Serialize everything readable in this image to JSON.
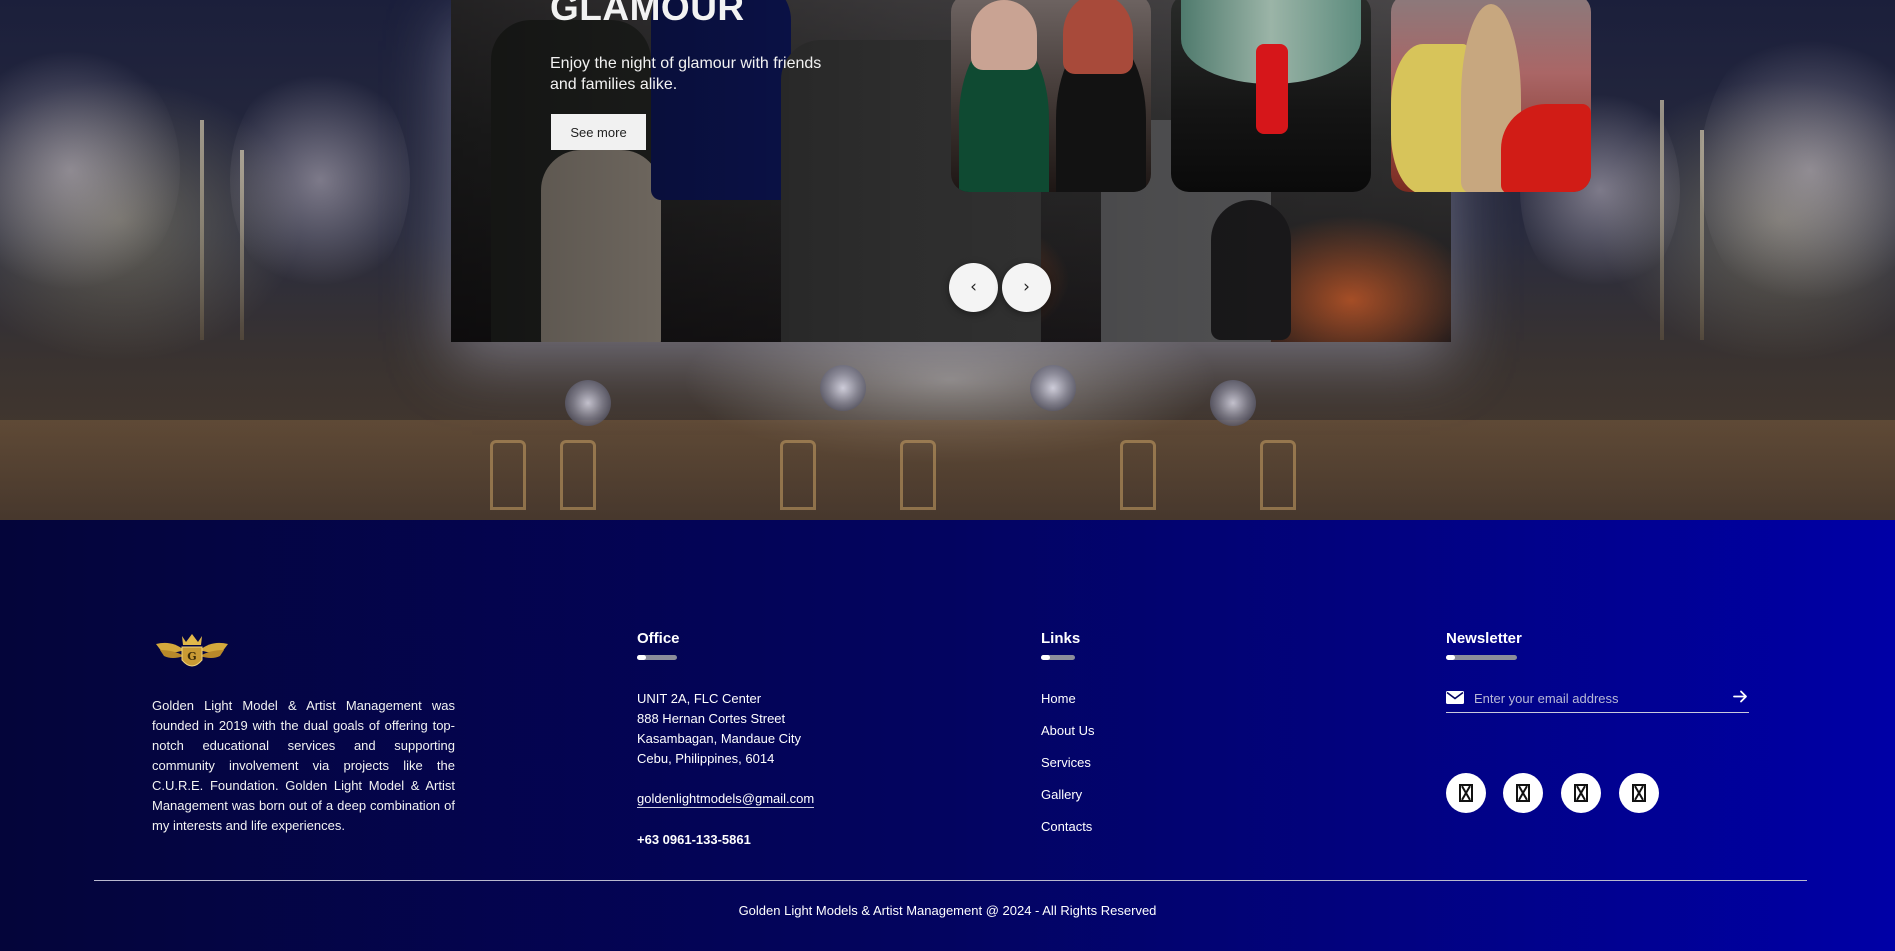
{
  "hero": {
    "slide": {
      "title": "GLAMOUR",
      "description": "Enjoy the night of glamour with friends and families alike.",
      "cta_label": "See more"
    },
    "nav": {
      "prev_icon": "chevron-left-icon",
      "prev_glyph": "‹",
      "next_icon": "chevron-right-icon",
      "next_glyph": "›"
    }
  },
  "footer": {
    "about": {
      "text": "Golden Light Model & Artist Management was founded in 2019 with the dual goals of offering top-notch educational services and supporting community involvement via projects like the C.U.R.E. Foundation. Golden Light Model & Artist Management was born out of a deep combination of my interests and life experiences."
    },
    "office": {
      "title": "Office",
      "address_lines": [
        "UNIT 2A, FLC Center",
        "888 Hernan Cortes Street",
        "Kasambagan, Mandaue City",
        "Cebu, Philippines, 6014"
      ],
      "email": "goldenlightmodels@gmail.com",
      "phone": "+63 0961-133-5861"
    },
    "links": {
      "title": "Links",
      "items": [
        "Home",
        "About Us",
        "Services",
        "Gallery",
        "Contacts"
      ]
    },
    "newsletter": {
      "title": "Newsletter",
      "placeholder": "Enter your email address",
      "social_icons": [
        "social-icon-1",
        "social-icon-2",
        "social-icon-3",
        "social-icon-4"
      ]
    },
    "copyright": "Golden Light Models & Artist Management @ 2024 - All Rights Reserved"
  },
  "colors": {
    "footer_bg_start": "#04053a",
    "footer_bg_end": "#0000a6",
    "logo_gold": "#d4a93c"
  }
}
